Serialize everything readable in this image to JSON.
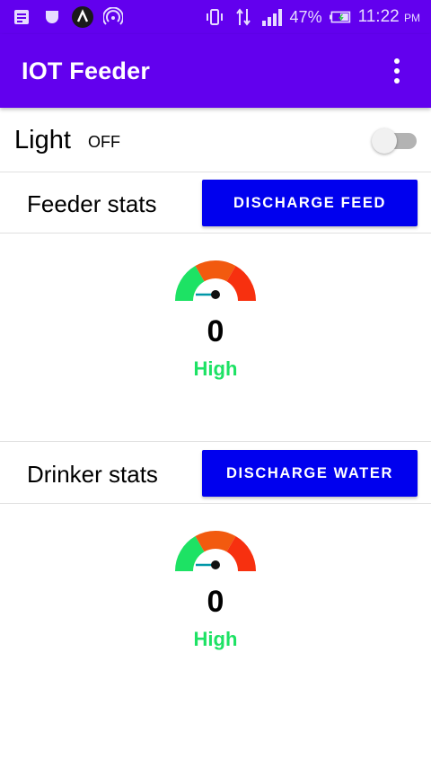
{
  "status_bar": {
    "icons_left": [
      "notification-icon",
      "sd-card-icon",
      "app-icon",
      "hotspot-icon"
    ],
    "icons_right": [
      "vibrate-icon",
      "data-arrows-icon",
      "signal-icon"
    ],
    "battery": "47%",
    "time": "11:22",
    "ampm": "PM"
  },
  "app_bar": {
    "title": "IOT Feeder",
    "menu_icon": "more-vert-icon"
  },
  "light": {
    "label": "Light",
    "state": "OFF",
    "switch_on": false
  },
  "feeder": {
    "title": "Feeder stats",
    "button": "DISCHARGE FEED",
    "value": "0",
    "level": "High"
  },
  "drinker": {
    "title": "Drinker stats",
    "button": "DISCHARGE WATER",
    "value": "0",
    "level": "High"
  },
  "colors": {
    "primary": "#6200ee",
    "button": "#0000ee",
    "gauge_green": "#1de264",
    "gauge_orange": "#f25a0f",
    "gauge_red": "#f7300f",
    "level_text": "#1de264"
  }
}
